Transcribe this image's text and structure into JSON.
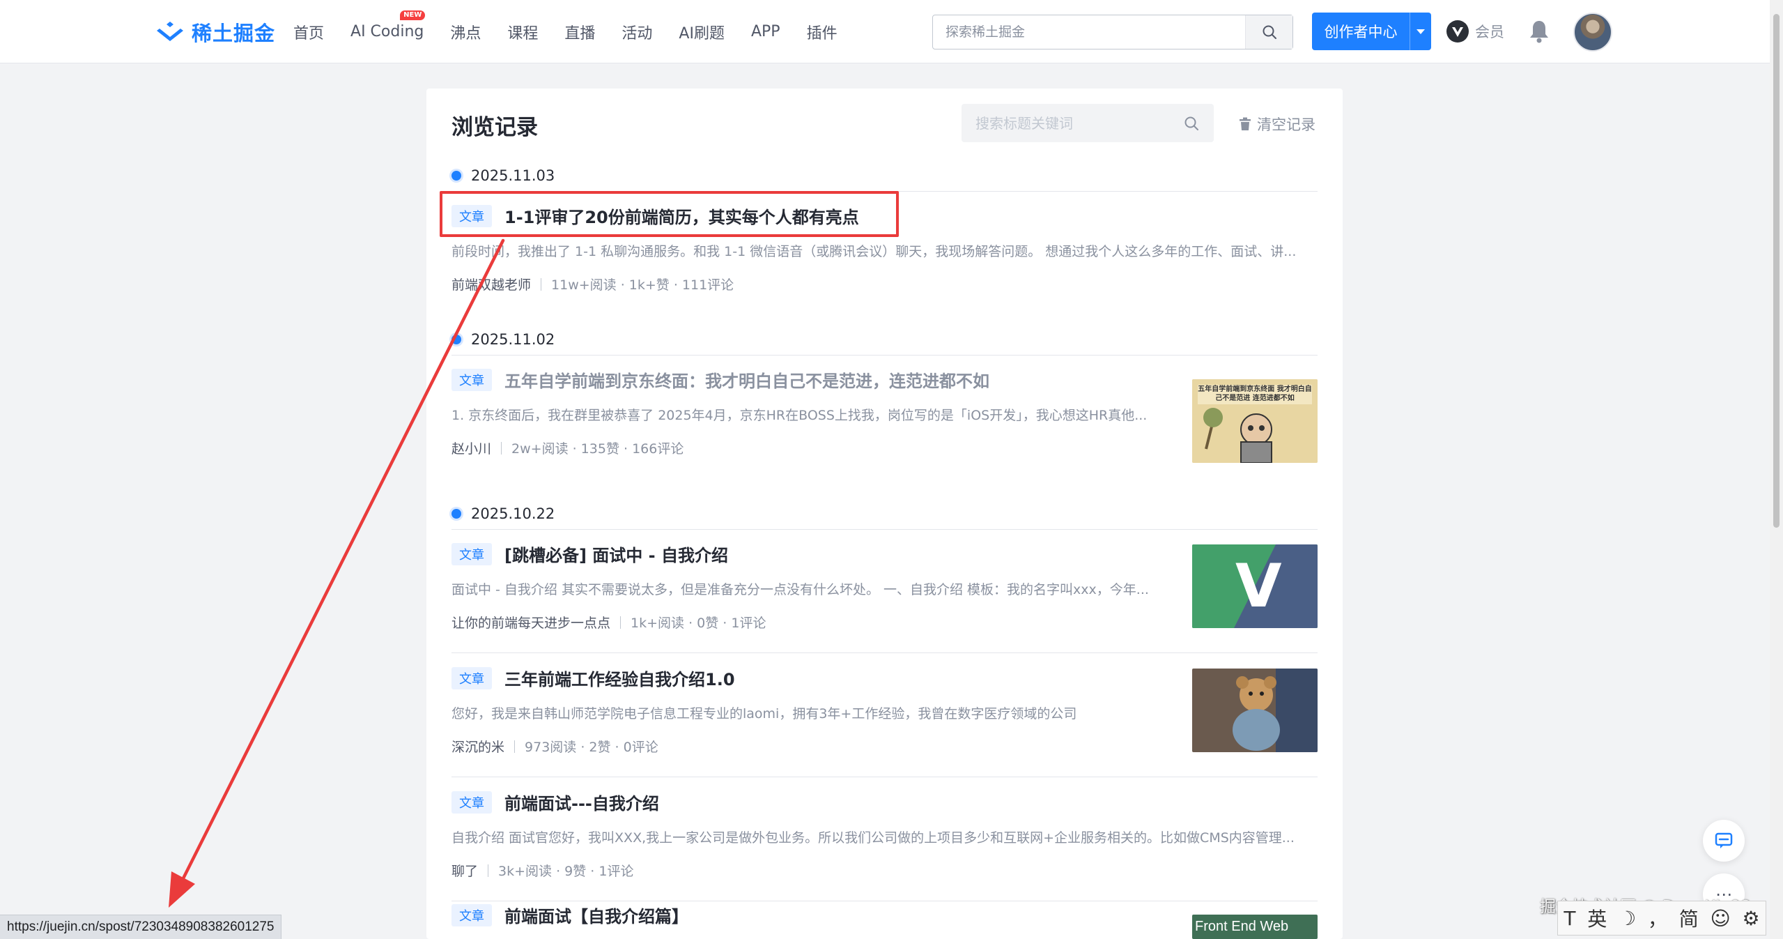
{
  "nav": {
    "logo_text": "稀土掘金",
    "links": [
      {
        "label": "首页",
        "badge": ""
      },
      {
        "label": "AI Coding",
        "badge": "NEW"
      },
      {
        "label": "沸点",
        "badge": ""
      },
      {
        "label": "课程",
        "badge": ""
      },
      {
        "label": "直播",
        "badge": ""
      },
      {
        "label": "活动",
        "badge": ""
      },
      {
        "label": "AI刷题",
        "badge": ""
      },
      {
        "label": "APP",
        "badge": ""
      },
      {
        "label": "插件",
        "badge": ""
      }
    ],
    "search_placeholder": "探索稀土掘金",
    "creator_label": "创作者中心",
    "vip_label": "会员"
  },
  "history": {
    "title": "浏览记录",
    "search_placeholder": "搜索标题关键词",
    "clear_label": "清空记录",
    "groups": [
      {
        "date": "2025.11.03",
        "articles": [
          {
            "tag": "文章",
            "title": "1-1评审了20份前端简历，其实每个人都有亮点",
            "desc": "前段时间，我推出了 1-1 私聊沟通服务。和我 1-1 微信语音（或腾讯会议）聊天，我现场解答问题。 想通过我个人这么多年的工作、面试、讲...",
            "author": "前端双越老师",
            "stats": "11w+阅读 · 1k+赞 · 111评论"
          }
        ]
      },
      {
        "date": "2025.11.02",
        "articles": [
          {
            "tag": "文章",
            "title": "五年自学前端到京东终面：我才明白自己不是范进，连范进都不如",
            "desc": "1. 京东终面后，我在群里被恭喜了 2025年4月，京东HR在BOSS上找我，岗位写的是「iOS开发」，我心想这HR真他...",
            "author": "赵小川",
            "stats": "2w+阅读 · 135赞 · 166评论",
            "thumb_caption": "五年自学前端到京东终面 我才明白自己不是范进 连范进都不如"
          }
        ]
      },
      {
        "date": "2025.10.22",
        "articles": [
          {
            "tag": "文章",
            "title": "[跳槽必备] 面试中 - 自我介绍",
            "desc": "面试中 - 自我介绍 其实不需要说太多，但是准备充分一点没有什么坏处。 一、自我介绍 模板：我的名字叫xxx，今年...",
            "author": "让你的前端每天进步一点点",
            "stats": "1k+阅读 · 0赞 · 1评论",
            "thumb_caption": "V"
          },
          {
            "tag": "文章",
            "title": "三年前端工作经验自我介绍1.0",
            "desc": "您好，我是来自韩山师范学院电子信息工程专业的laomi，拥有3年+工作经验，我曾在数字医疗领域的公司",
            "author": "深沉的米",
            "stats": "973阅读 · 2赞 · 0评论"
          },
          {
            "tag": "文章",
            "title": "前端面试---自我介绍",
            "desc": "自我介绍 面试官您好，我叫XXX,我上一家公司是做外包业务。所以我们公司做的上项目多少和互联网+企业服务相关的。比如做CMS内容管理...",
            "author": "聊了",
            "stats": "3k+阅读 · 9赞 · 1评论"
          },
          {
            "tag": "文章",
            "title": "前端面试【自我介绍篇】",
            "thumb_caption": "Front End Web"
          }
        ]
      }
    ]
  },
  "overlay": {
    "watermark": "掘金技术社区 @ DengXin98",
    "status_url": "https://juejin.cn/spost/7230348908382601275",
    "ime": [
      "T",
      "英",
      "☽",
      "，",
      "简",
      "☺",
      "⚙"
    ]
  },
  "colors": {
    "brand": "#1e80ff",
    "annotation": "#ea3b3b",
    "bg": "#f2f3f5"
  }
}
